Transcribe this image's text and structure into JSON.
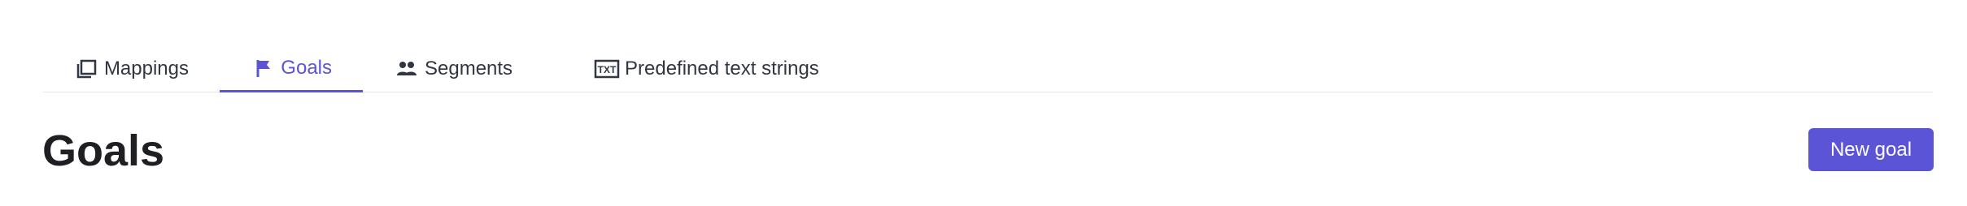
{
  "tabs": [
    {
      "label": "Mappings",
      "icon": "mappings-icon",
      "active": false
    },
    {
      "label": "Goals",
      "icon": "flag-icon",
      "active": true
    },
    {
      "label": "Segments",
      "icon": "users-icon",
      "active": false
    },
    {
      "label": "Predefined text strings",
      "icon": "txt-icon",
      "active": false
    }
  ],
  "page": {
    "title": "Goals",
    "new_button_label": "New goal"
  },
  "colors": {
    "accent": "#5b54d6",
    "border": "#e5e7eb",
    "text": "#303642"
  }
}
